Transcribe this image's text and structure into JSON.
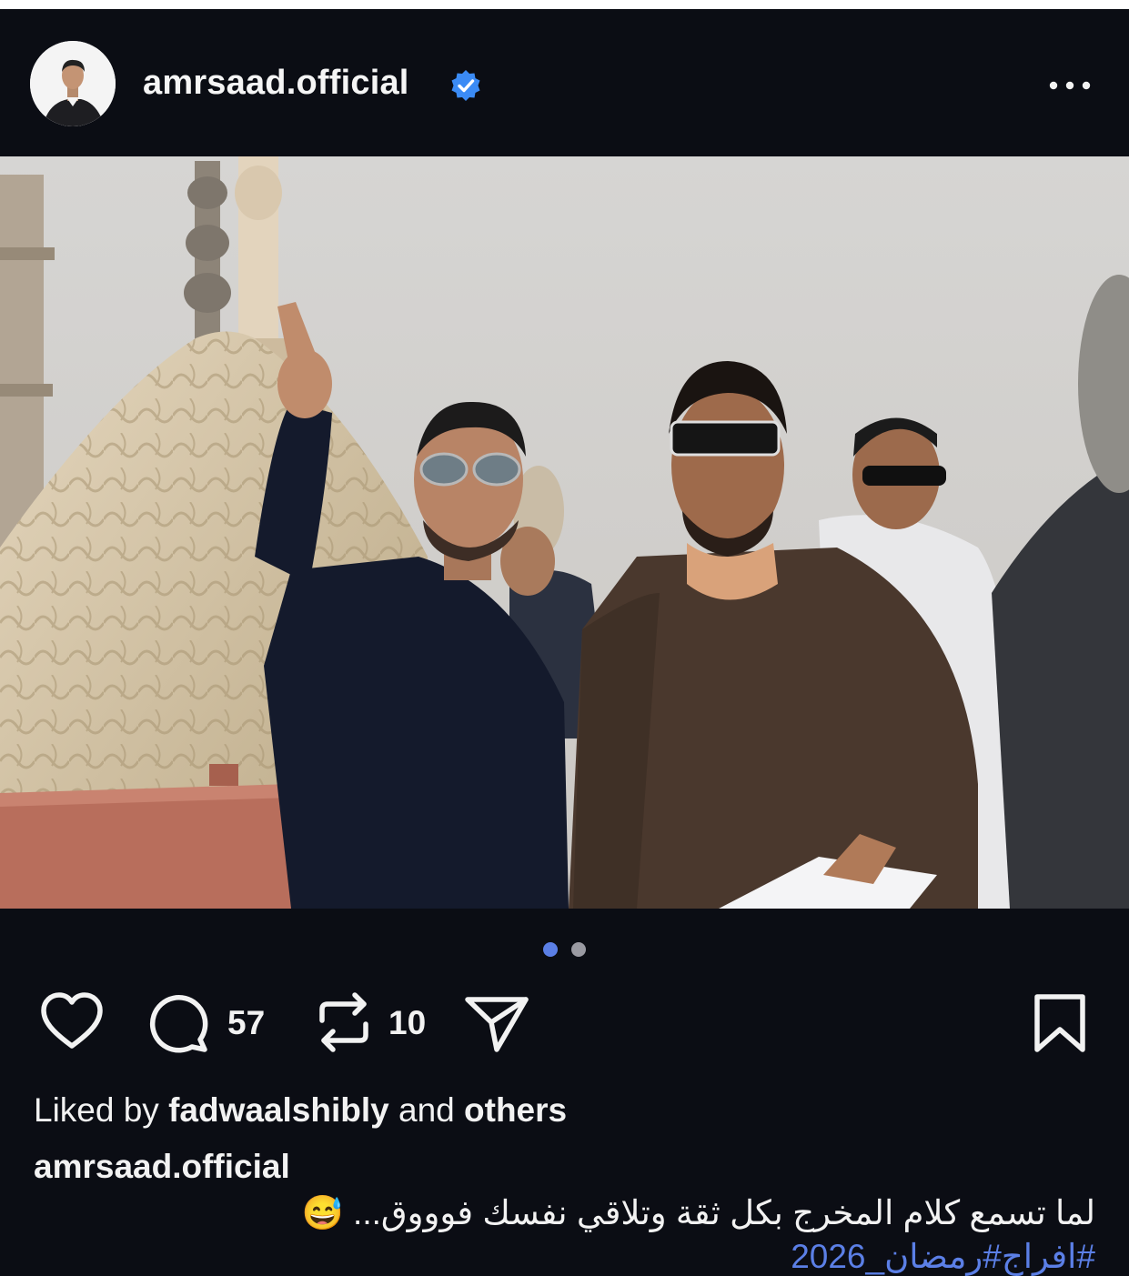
{
  "post": {
    "username": "amrsaad.official",
    "verified": true,
    "more_icon": "ellipsis-icon",
    "carousel": {
      "total": 2,
      "current": 1
    },
    "colors": {
      "background": "#0b0d14",
      "active_dot": "#5b7fe6",
      "inactive_dot": "#9a9aa2",
      "hashtag": "#5b7fe6",
      "verified_badge": "#3b8bf5"
    }
  },
  "actions": {
    "like_icon": "heart-icon",
    "comment_icon": "comment-bubble-icon",
    "comment_count": "57",
    "repost_icon": "repost-icon",
    "repost_count": "10",
    "share_icon": "send-icon",
    "save_icon": "bookmark-icon"
  },
  "likes": {
    "prefix": "Liked by",
    "user": "fadwaalshibly",
    "connector": "and",
    "others": "others"
  },
  "caption": {
    "username": "amrsaad.official",
    "text": "لما تسمع كلام المخرج بكل ثقة وتلاقي نفسك فوووق... 😅",
    "hashtags": "#افراج#رمضان_2026"
  }
}
